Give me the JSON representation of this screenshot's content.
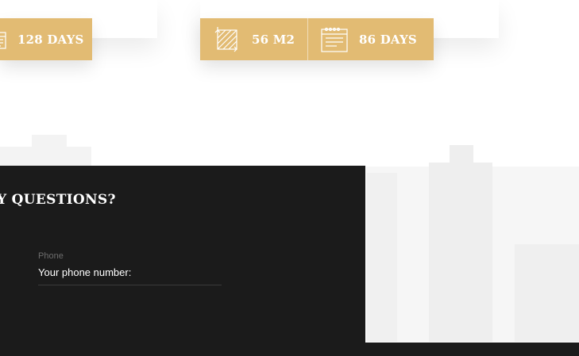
{
  "listings": [
    {
      "stats": [
        {
          "icon": "calendar-icon",
          "value": "128 DAYS"
        }
      ]
    },
    {
      "stats": [
        {
          "icon": "area-icon",
          "value": "56 M2"
        },
        {
          "icon": "calendar-icon",
          "value": "86 DAYS"
        }
      ]
    }
  ],
  "contact": {
    "heading": "Y QUESTIONS?",
    "phone": {
      "label": "Phone",
      "value": "Your phone number:"
    }
  },
  "colors": {
    "accent": "#e2bb73",
    "dark": "#1b1b1b"
  }
}
